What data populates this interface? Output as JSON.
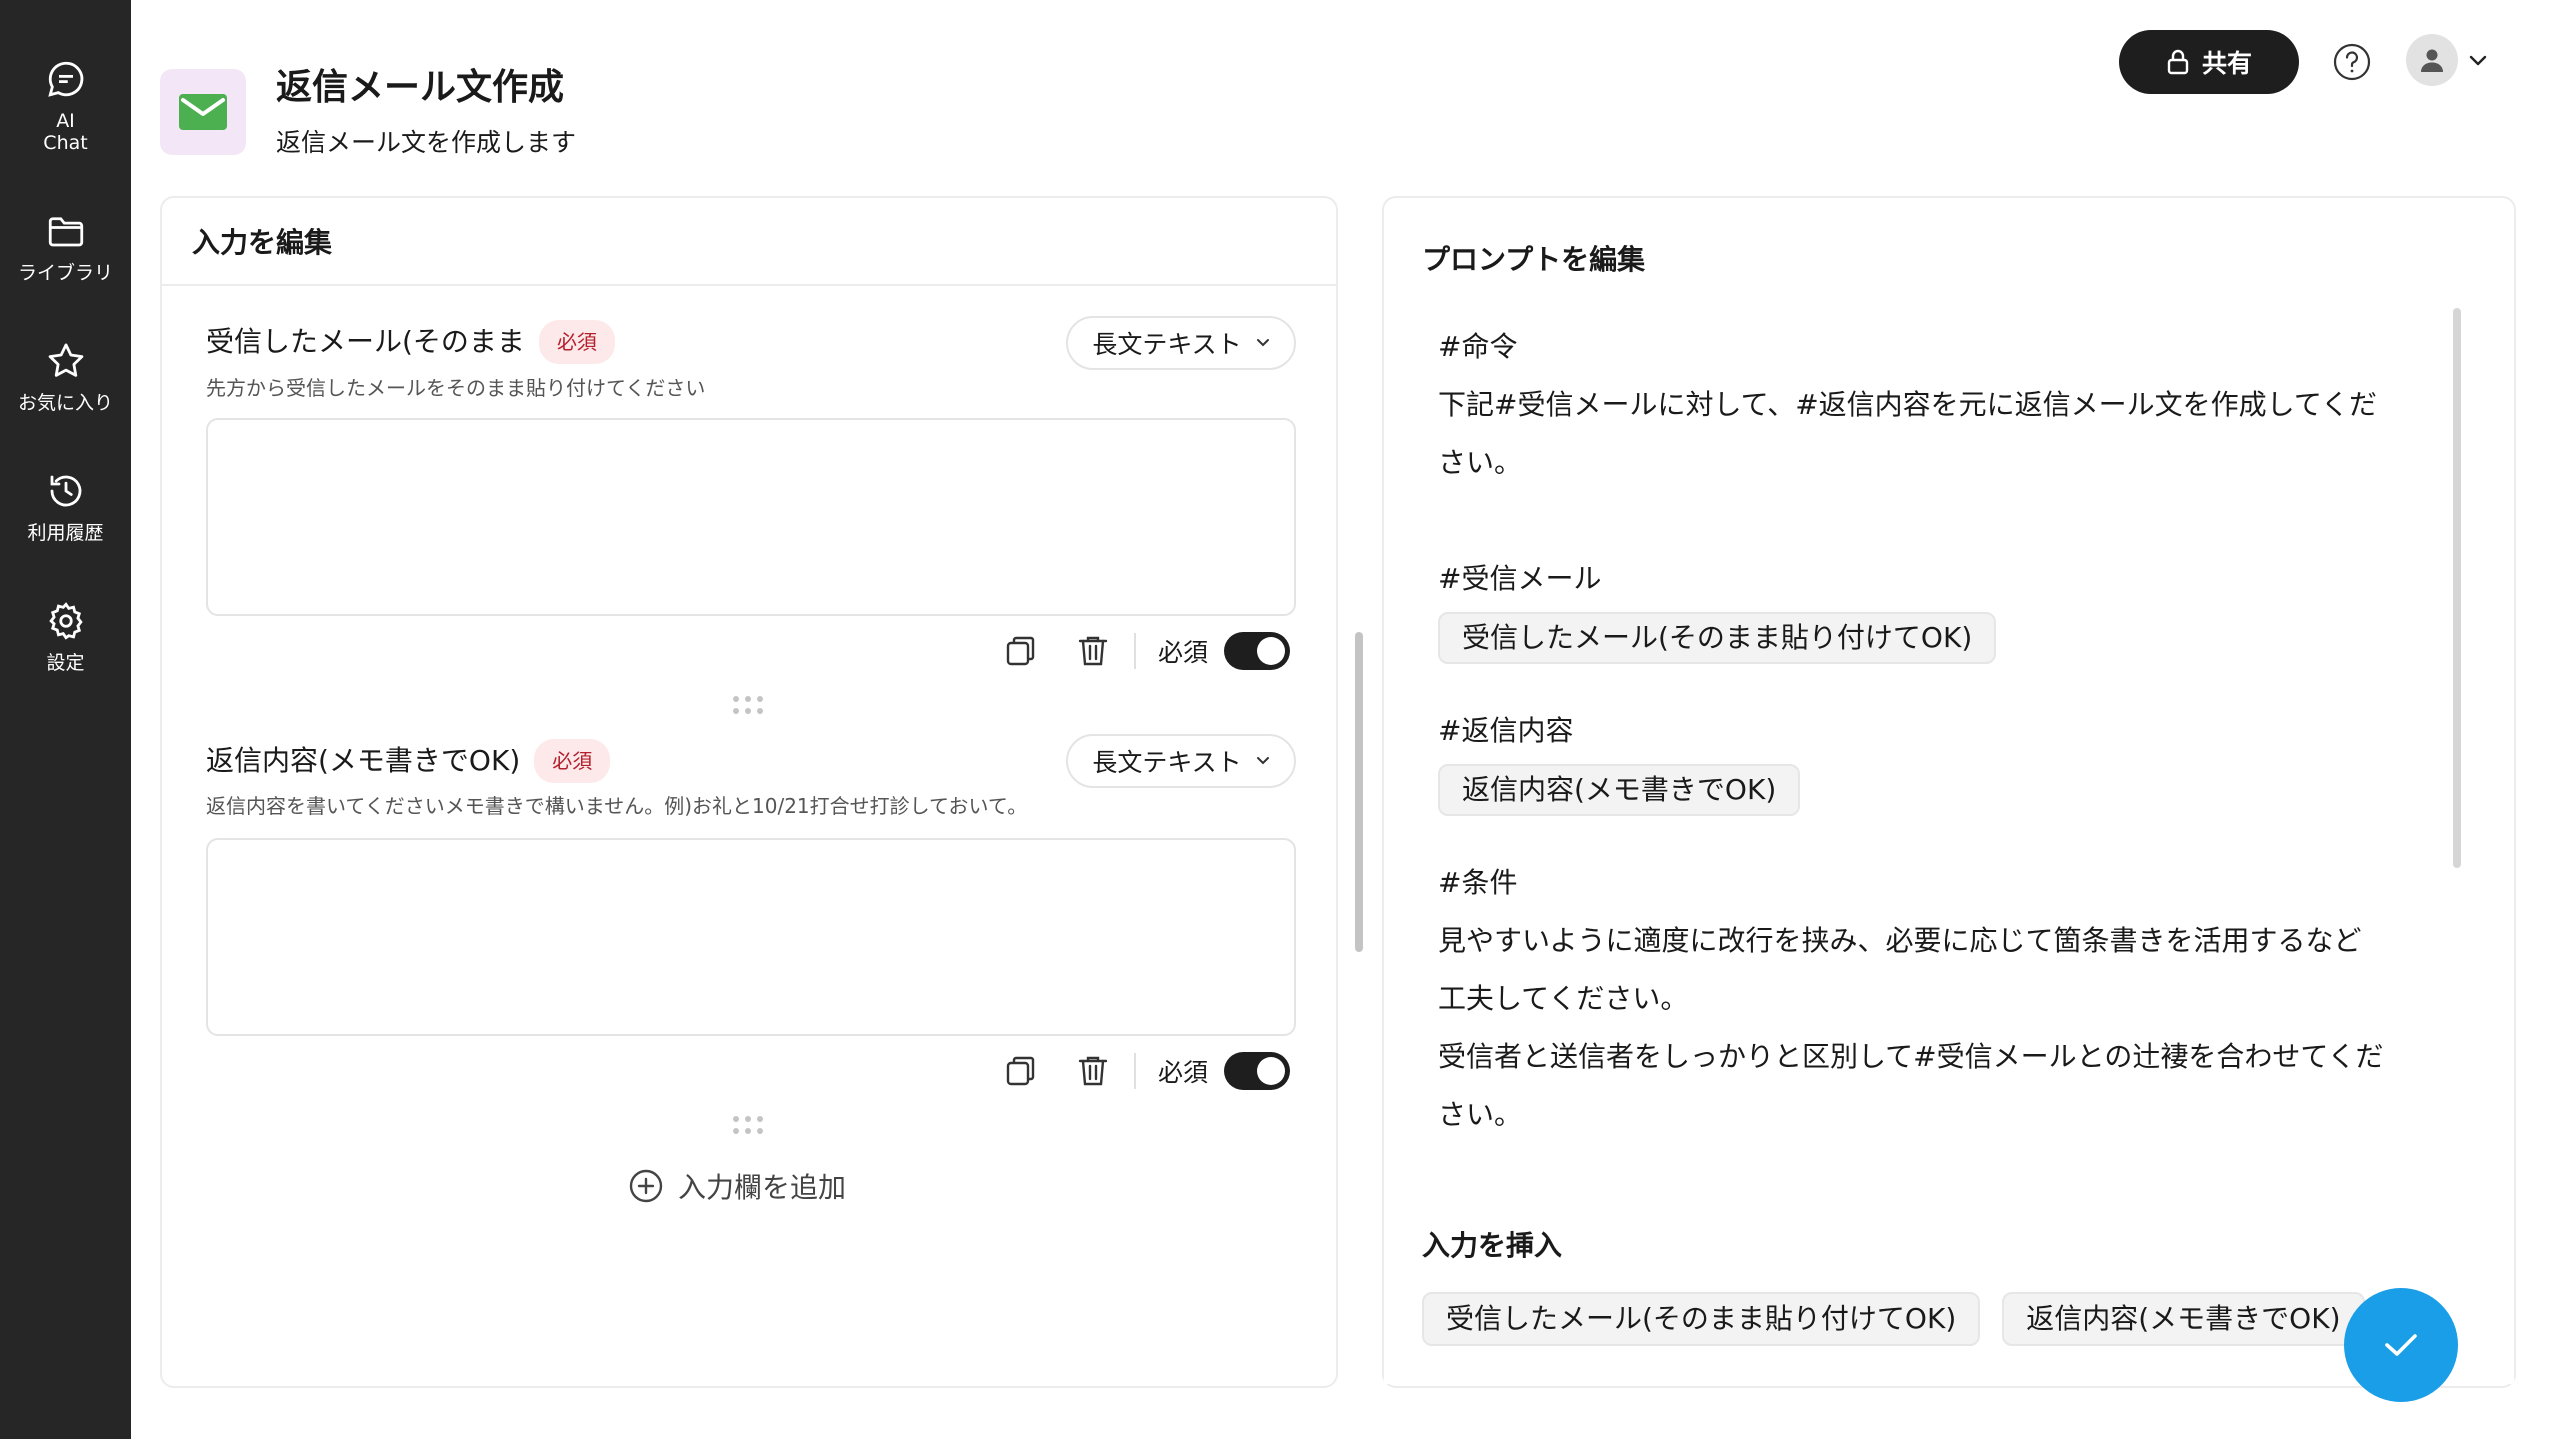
{
  "sidebar": {
    "items": [
      {
        "label": "AI\nChat",
        "icon": "chat-icon"
      },
      {
        "label": "ライブラリ",
        "icon": "folder-icon"
      },
      {
        "label": "お気に入り",
        "icon": "star-icon"
      },
      {
        "label": "利用履歴",
        "icon": "history-icon"
      },
      {
        "label": "設定",
        "icon": "gear-icon"
      }
    ]
  },
  "header": {
    "title": "返信メール文作成",
    "subtitle": "返信メール文を作成します",
    "share_label": "共有",
    "app_icon": "mail-icon",
    "app_icon_color": "#4caf50"
  },
  "left_panel": {
    "title": "入力を編集",
    "fields": [
      {
        "label": "受信したメール(そのまま",
        "required_badge": "必須",
        "type": "長文テキスト",
        "description": "先方から受信したメールをそのまま貼り付けてください",
        "value": "",
        "required_label": "必須",
        "required_on": true
      },
      {
        "label": "返信内容(メモ書きでOK)",
        "required_badge": "必須",
        "type": "長文テキスト",
        "description": "返信内容を書いてくださいメモ書きで構いません。例)お礼と10/21打合せ打診しておいて。",
        "value": "",
        "required_label": "必須",
        "required_on": true
      }
    ],
    "add_field_label": "入力欄を追加"
  },
  "right_panel": {
    "title": "プロンプトを編集",
    "prompt": {
      "h1": "#命令",
      "l1": "下記#受信メールに対して、#返信内容を元に返信メール文を作成してくだ",
      "l2": "さい。",
      "h2": "#受信メール",
      "chip1": "受信したメール(そのまま貼り付けてOK)",
      "h3": "#返信内容",
      "chip2": "返信内容(メモ書きでOK)",
      "h4": "#条件",
      "l3": "見やすいように適度に改行を挟み、必要に応じて箇条書きを活用するなど",
      "l4": "工夫してください。",
      "l5": "受信者と送信者をしっかりと区別して#受信メールとの辻褄を合わせてくだ",
      "l6": "さい。"
    },
    "insert_title": "入力を挿入",
    "insert_chips": [
      "受信したメール(そのまま貼り付けてOK)",
      "返信内容(メモ書きでOK)"
    ]
  },
  "colors": {
    "sidebar_bg": "#262626",
    "fab": "#1a9ee8",
    "badge_bg": "#fde8ea",
    "badge_text": "#b3202c"
  }
}
